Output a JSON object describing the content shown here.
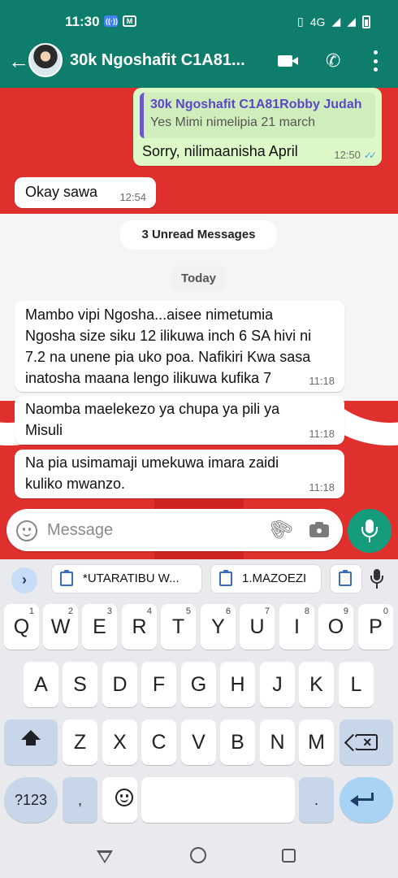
{
  "status_bar": {
    "time": "11:30",
    "network": "4G"
  },
  "chat_header": {
    "title": "30k Ngoshafit C1A81...",
    "accent_color": "#0f7d6b"
  },
  "messages": {
    "outgoing_reply": {
      "quoted_name": "30k Ngoshafit C1A81Robby Judah",
      "quoted_text": "Yes Mimi nimelipia 21 march",
      "text": "Sorry, nilimaanisha April",
      "time": "12:50",
      "status": "read"
    },
    "incoming_1": {
      "text": "Okay sawa",
      "time": "12:54"
    },
    "unread_divider": "3 Unread Messages",
    "date_divider": "Today",
    "incoming_2": {
      "text": "Mambo vipi Ngosha...aisee nimetumia\nNgosha size siku 12 ilikuwa inch 6 SA hivi ni\n7.2 na unene pia uko poa. Nafikiri Kwa sasa\ninatosha maana lengo ilikuwa kufika 7",
      "time": "11:18"
    },
    "incoming_3": {
      "text": "Naomba maelekezo ya chupa ya pili ya\nMisuli",
      "time": "11:18"
    },
    "incoming_4": {
      "text": "Na pia usimamaji umekuwa imara zaidi\nkuliko mwanzo.",
      "time": "11:18"
    }
  },
  "composer": {
    "placeholder": "Message"
  },
  "keyboard": {
    "clipboard_chips": [
      "*UTARATIBU W...",
      "1.MAZOEZI"
    ],
    "row1": [
      {
        "key": "Q",
        "hint": "1"
      },
      {
        "key": "W",
        "hint": "2"
      },
      {
        "key": "E",
        "hint": "3"
      },
      {
        "key": "R",
        "hint": "4"
      },
      {
        "key": "T",
        "hint": "5"
      },
      {
        "key": "Y",
        "hint": "6"
      },
      {
        "key": "U",
        "hint": "7"
      },
      {
        "key": "I",
        "hint": "8"
      },
      {
        "key": "O",
        "hint": "9"
      },
      {
        "key": "P",
        "hint": "0"
      }
    ],
    "row2": [
      "A",
      "S",
      "D",
      "F",
      "G",
      "H",
      "J",
      "K",
      "L"
    ],
    "row3": [
      "Z",
      "X",
      "C",
      "V",
      "B",
      "N",
      "M"
    ],
    "symbols_key": "?123",
    "comma_key": ",",
    "period_key": "."
  }
}
